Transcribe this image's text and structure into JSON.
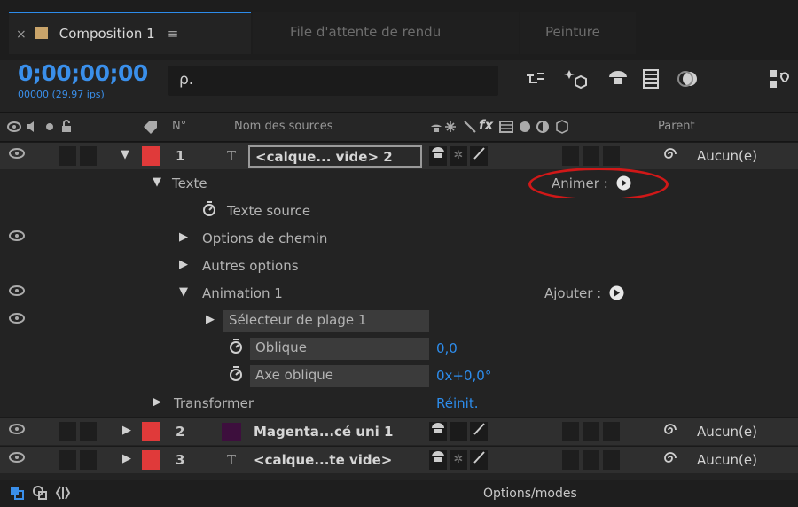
{
  "tabs": {
    "composition": {
      "close": "×",
      "label": "Composition 1",
      "menu": "≡"
    },
    "render_queue": {
      "label": "File d'attente de rendu"
    },
    "paint": {
      "label": "Peinture"
    }
  },
  "header": {
    "timecode": "0;00;00;00",
    "frame_info": "00000 (29.97 ips)",
    "search_glyph": "ρ."
  },
  "columns": {
    "num": "N°",
    "source_name": "Nom des sources",
    "fx": "fx",
    "parent": "Parent"
  },
  "layers": [
    {
      "num": "1",
      "type_icon": "T",
      "name": "<calque... vide> 2",
      "parent": "Aucun(e)",
      "color": "#e03a3a"
    },
    {
      "num": "2",
      "type_icon": "",
      "name": "Magenta...cé uni 1",
      "parent": "Aucun(e)",
      "color": "#e03a3a"
    },
    {
      "num": "3",
      "type_icon": "T",
      "name": "<calque...te vide>",
      "parent": "Aucun(e)",
      "color": "#e03a3a"
    }
  ],
  "properties": {
    "text_group": "Texte",
    "animate_label": "Animer :",
    "source_text": "Texte source",
    "path_options": "Options de chemin",
    "more_options": "Autres options",
    "animation_1": "Animation 1",
    "add_label": "Ajouter :",
    "range_selector": "Sélecteur de plage 1",
    "skew": "Oblique",
    "skew_value": "0,0",
    "skew_axis": "Axe oblique",
    "skew_axis_value": "0x+0,0°",
    "transform": "Transformer",
    "reset": "Réinit."
  },
  "footer": {
    "options_modes": "Options/modes"
  },
  "colors": {
    "accent": "#2d8ceb",
    "label_red": "#e03a3a",
    "highlight_ellipse": "#d01818"
  }
}
